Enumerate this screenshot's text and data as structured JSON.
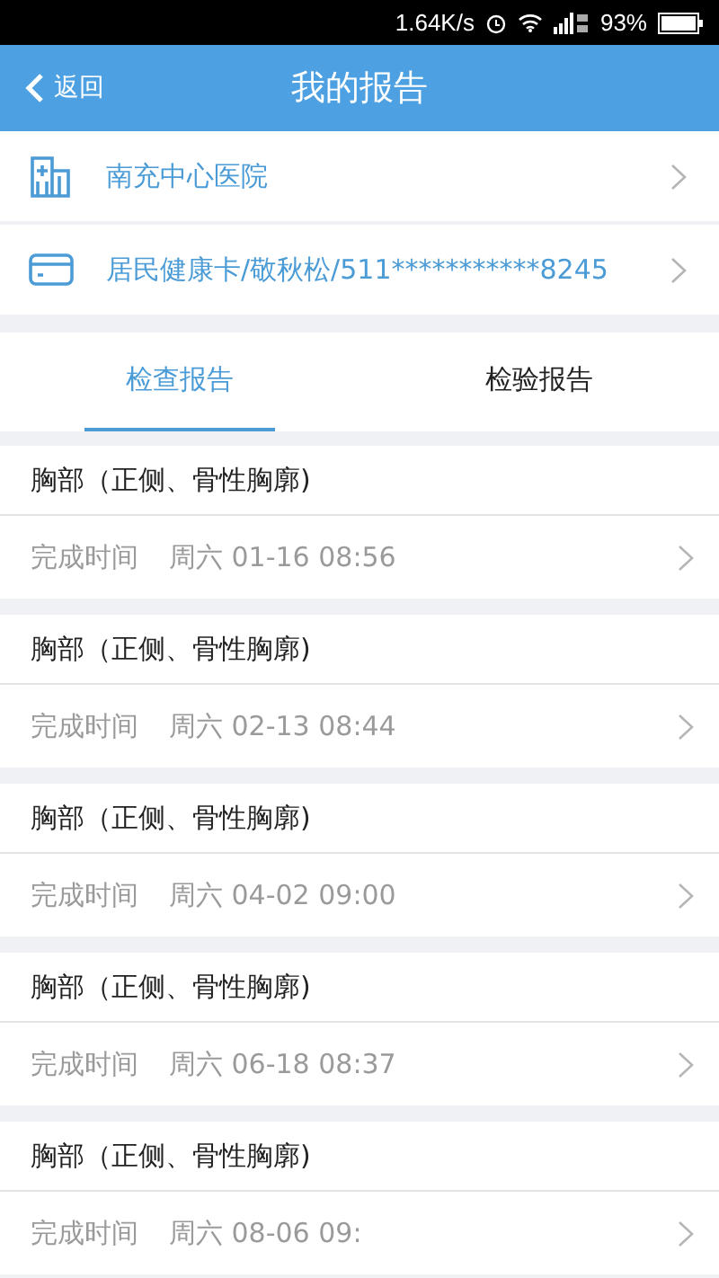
{
  "status_bar": {
    "speed": "1.64K/s",
    "battery": "93%"
  },
  "header": {
    "back": "返回",
    "title": "我的报告"
  },
  "info_rows": [
    {
      "kind": "hospital",
      "text": "南充中心医院"
    },
    {
      "kind": "card",
      "text": "居民健康卡/敬秋松/511***********8245"
    }
  ],
  "tabs": [
    {
      "label": "检查报告",
      "selected": true
    },
    {
      "label": "检验报告",
      "selected": false
    }
  ],
  "reports": [
    {
      "title": "胸部（正侧、骨性胸廓)",
      "time_label": "完成时间",
      "time": "周六 01-16 08:56"
    },
    {
      "title": "胸部（正侧、骨性胸廓)",
      "time_label": "完成时间",
      "time": "周六 02-13 08:44"
    },
    {
      "title": "胸部（正侧、骨性胸廓)",
      "time_label": "完成时间",
      "time": "周六 04-02 09:00"
    },
    {
      "title": "胸部（正侧、骨性胸廓)",
      "time_label": "完成时间",
      "time": "周六 06-18 08:37"
    },
    {
      "title": "胸部（正侧、骨性胸廓)",
      "time_label": "完成时间",
      "time": "周六 08-06 09:"
    }
  ]
}
